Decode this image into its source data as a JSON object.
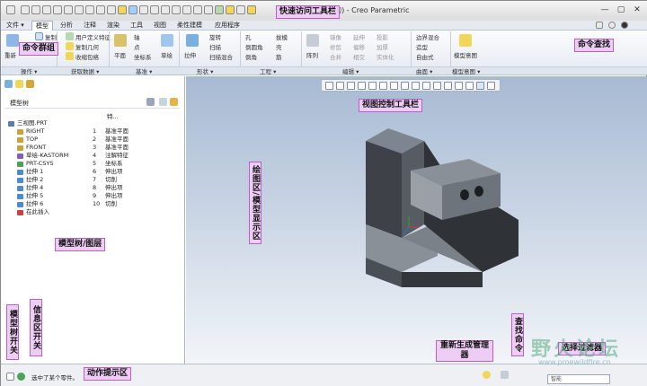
{
  "window": {
    "title": "三视图 (活动的) - Creo Parametric",
    "controls": [
      "—",
      "▢",
      "✕"
    ]
  },
  "menus": [
    {
      "label": "文件 ▾",
      "active": false
    },
    {
      "label": "模型",
      "active": true
    },
    {
      "label": "分析",
      "active": false
    },
    {
      "label": "注释",
      "active": false
    },
    {
      "label": "渲染",
      "active": false
    },
    {
      "label": "工具",
      "active": false
    },
    {
      "label": "视图",
      "active": false
    },
    {
      "label": "柔性建模",
      "active": false
    },
    {
      "label": "应用程序",
      "active": false
    }
  ],
  "ribbon": {
    "row1": [
      "重新",
      "复制",
      "用户定义特征",
      "轴",
      "拉伸",
      "旋转",
      "孔",
      "拔模",
      "阵列",
      "镜像",
      "延伸",
      "投影",
      "边界混合",
      "模型意图"
    ],
    "row2": [
      "粘贴",
      "复制几何",
      "点",
      "扫描",
      "倒圆角",
      "壳",
      "修剪",
      "相交",
      "造型"
    ],
    "row3": [
      "收缩包络",
      "坐标系",
      "扫描混合",
      "倒角",
      "筋",
      "合并",
      "实体化",
      "自由式"
    ],
    "extra": [
      "平面",
      "草绘",
      "偏移",
      "加厚",
      "曲面"
    ]
  },
  "groups": [
    "操作 ▾",
    "获取数据 ▾",
    "基准 ▾",
    "形状 ▾",
    "工程 ▾",
    "编辑 ▾",
    "曲面 ▾",
    "模型意图 ▾"
  ],
  "tree": {
    "title": "模型树",
    "col_name": "",
    "col_id": "特...",
    "rows": [
      {
        "name": "三视图.PRT",
        "num": "",
        "type": "",
        "indent": 0,
        "icon": "#5a7bb5"
      },
      {
        "name": "RIGHT",
        "num": "1",
        "type": "基准平面",
        "indent": 1,
        "icon": "#c9a23a"
      },
      {
        "name": "TOP",
        "num": "2",
        "type": "基准平面",
        "indent": 1,
        "icon": "#c9a23a"
      },
      {
        "name": "FRONT",
        "num": "3",
        "type": "基准平面",
        "indent": 1,
        "icon": "#c9a23a"
      },
      {
        "name": "草绘-KASTORM",
        "num": "4",
        "type": "注解特征",
        "indent": 1,
        "icon": "#8a5bbf"
      },
      {
        "name": "PRT-CSYS",
        "num": "5",
        "type": "坐标系",
        "indent": 1,
        "icon": "#4aa35a"
      },
      {
        "name": "拉伸 1",
        "num": "6",
        "type": "伸出项",
        "indent": 1,
        "icon": "#4d8bd1"
      },
      {
        "name": "拉伸 2",
        "num": "7",
        "type": "切削",
        "indent": 1,
        "icon": "#4d8bd1"
      },
      {
        "name": "拉伸 4",
        "num": "8",
        "type": "伸出项",
        "indent": 1,
        "icon": "#4d8bd1"
      },
      {
        "name": "拉伸 5",
        "num": "9",
        "type": "伸出项",
        "indent": 1,
        "icon": "#4d8bd1"
      },
      {
        "name": "拉伸 6",
        "num": "10",
        "type": "切削",
        "indent": 1,
        "icon": "#4d8bd1"
      },
      {
        "name": "在此插入",
        "num": "",
        "type": "",
        "indent": 1,
        "icon": "#d04040"
      }
    ]
  },
  "status": {
    "message": "选中了某个零件。",
    "filter": "智能"
  },
  "annotations": {
    "quick_access": "快速访问工具栏",
    "command_group": "命令群组",
    "command_search": "命令查找",
    "view_toolbar": "视图控制工具栏",
    "graphics_area": "绘图区/模型显示区",
    "model_tree": "模型树/图层",
    "tree_toggle": "模型树开关",
    "message_toggle": "信息区开关",
    "action_prompt": "动作提示区",
    "regen_manager": "重新生成管理器",
    "find_command": "查找命令",
    "selection_filter": "选择过滤器"
  },
  "watermark": {
    "text": "野火论坛",
    "url": "www.proewildfire.cn"
  }
}
